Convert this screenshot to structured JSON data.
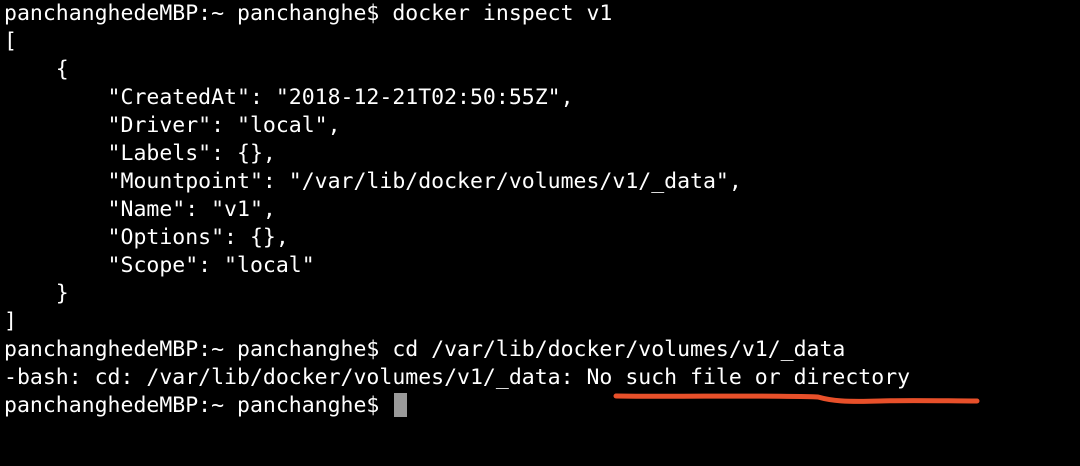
{
  "terminal": {
    "lines": [
      "panchanghedeMBP:~ panchanghe$ docker inspect v1",
      "[",
      "    {",
      "        \"CreatedAt\": \"2018-12-21T02:50:55Z\",",
      "        \"Driver\": \"local\",",
      "        \"Labels\": {},",
      "        \"Mountpoint\": \"/var/lib/docker/volumes/v1/_data\",",
      "        \"Name\": \"v1\",",
      "        \"Options\": {},",
      "        \"Scope\": \"local\"",
      "    }",
      "]",
      "panchanghedeMBP:~ panchanghe$ cd /var/lib/docker/volumes/v1/_data",
      "-bash: cd: /var/lib/docker/volumes/v1/_data: No such file or directory",
      "panchanghedeMBP:~ panchanghe$ "
    ]
  },
  "colors": {
    "background": "#000000",
    "text": "#ffffff",
    "cursor": "#9a9a9a",
    "annotation": "#e8502a"
  }
}
